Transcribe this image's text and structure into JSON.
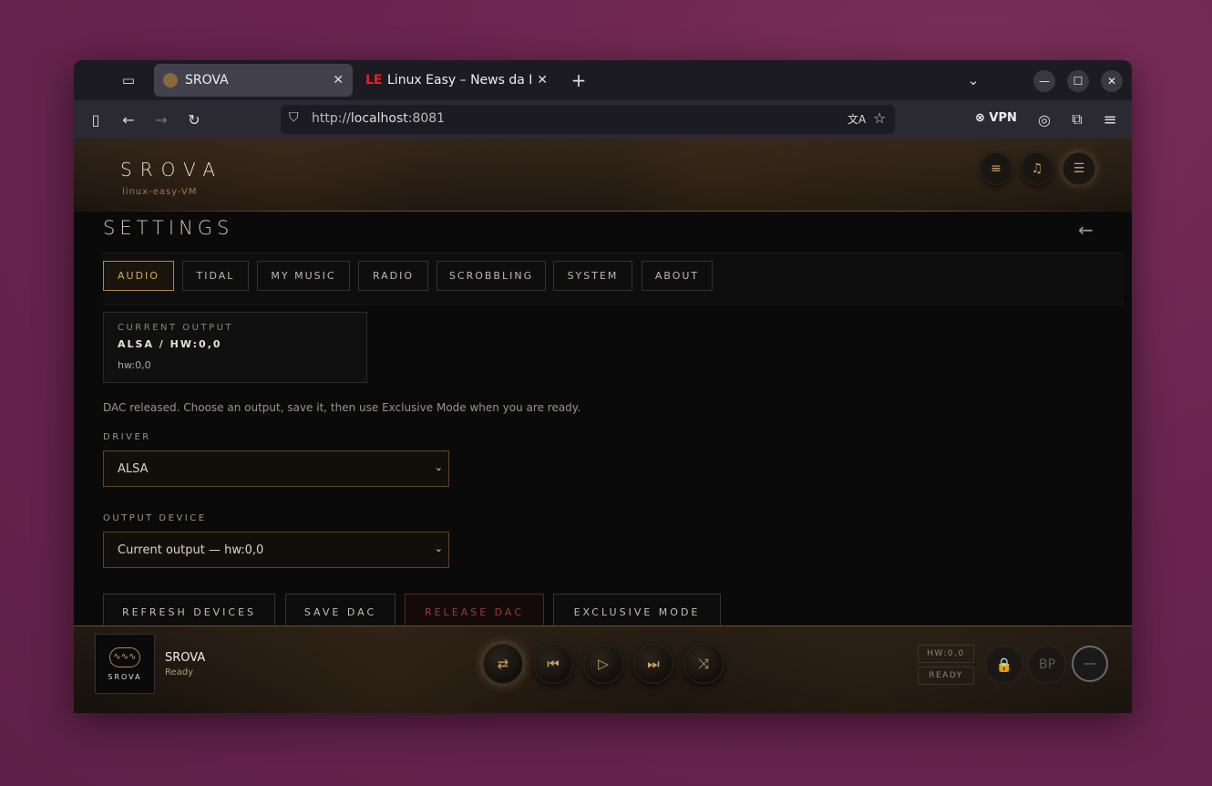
{
  "browser": {
    "tabs": [
      {
        "title": "SROVA",
        "active": true
      },
      {
        "title": "Linux Easy – News da Mon",
        "active": false
      }
    ],
    "url_prefix": "http://",
    "url_host": "localhost",
    "url_port": ":8081",
    "vpn_label": "VPN",
    "icons": {
      "close_tab": "✕",
      "new_tab": "+",
      "tab_list": "⌄",
      "minimize": "—",
      "maximize": "☐",
      "close_window": "✕",
      "back": "←",
      "forward": "→",
      "reload": "↻",
      "translate": "文A",
      "bookmark": "☆",
      "account": "◎",
      "extensions": "⧉",
      "menu": "≡"
    }
  },
  "app": {
    "brand": "SROVA",
    "hostname": "linux-easy-VM",
    "settings_title": "SETTINGS",
    "back_icon": "←",
    "tabs": [
      "AUDIO",
      "TIDAL",
      "MY MUSIC",
      "RADIO",
      "SCROBBLING",
      "SYSTEM",
      "ABOUT"
    ],
    "active_tab": "AUDIO",
    "current_output": {
      "label": "CURRENT OUTPUT",
      "value": "ALSA / HW:0,0",
      "sub": "hw:0,0"
    },
    "dac_note": "DAC released. Choose an output, save it, then use Exclusive Mode when you are ready.",
    "driver": {
      "label": "DRIVER",
      "value": "ALSA"
    },
    "output_device": {
      "label": "OUTPUT DEVICE",
      "value": "Current output — hw:0,0"
    },
    "buttons": {
      "refresh": "REFRESH DEVICES",
      "save": "SAVE DAC",
      "release": "RELEASE DAC",
      "exclusive": "EXCLUSIVE MODE"
    },
    "colors": {
      "accent": "#c9a46a",
      "danger": "#9a3b3b"
    }
  },
  "player": {
    "art_label": "SROVA",
    "track_title": "SROVA",
    "track_status": "Ready",
    "device_badge": "HW:0,0",
    "state_badge": "READY",
    "bp_label": "BP",
    "icons": {
      "repeat": "⇄",
      "previous": "⏮",
      "play": "▷",
      "next": "⏭",
      "shuffle": "⤨",
      "lock": "🔒",
      "volume": "—"
    }
  }
}
